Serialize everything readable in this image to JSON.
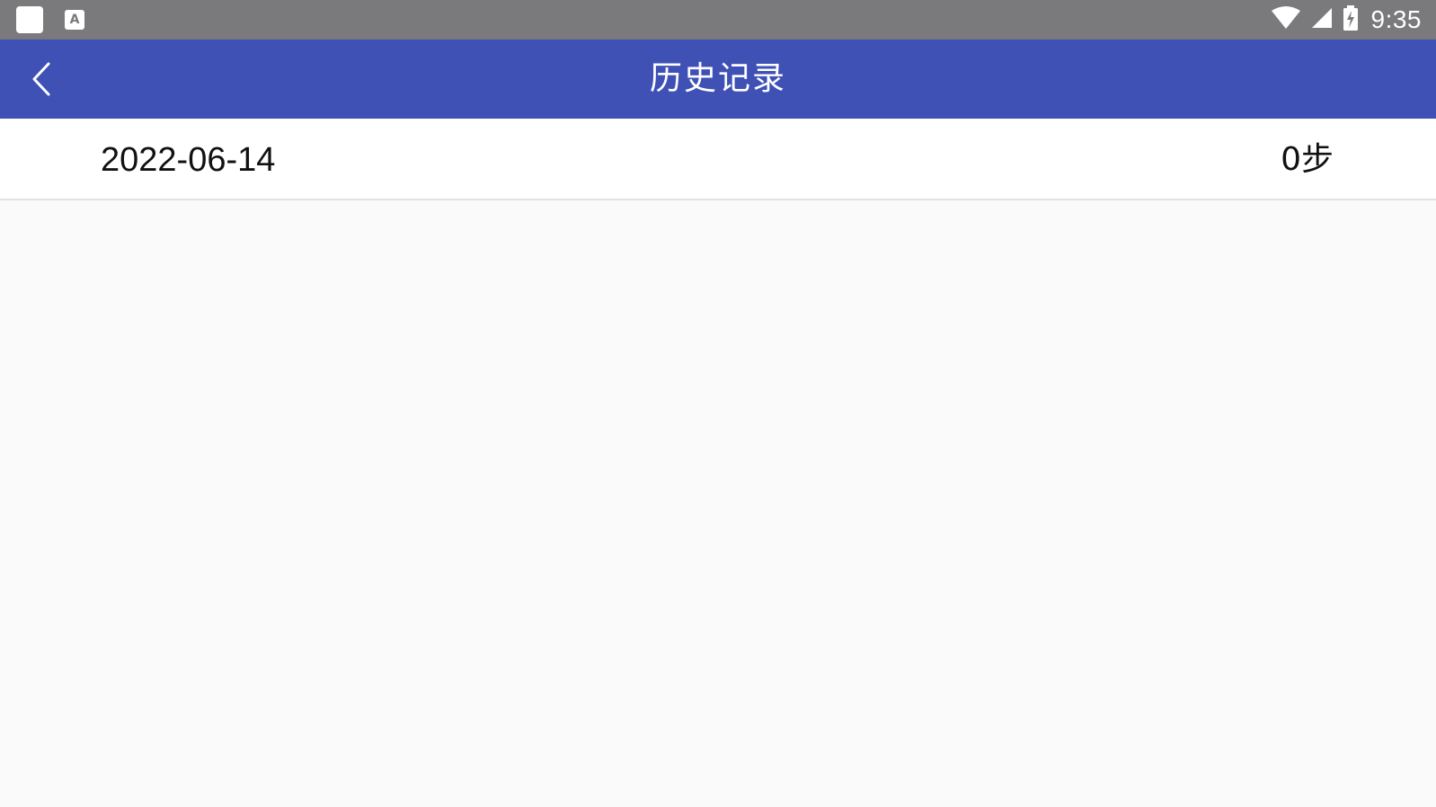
{
  "status_bar": {
    "time": "9:35",
    "notification_icons": [
      "app-square-icon",
      "keyboard-a-icon"
    ],
    "notification_a_letter": "A",
    "system_icons": [
      "wifi-icon",
      "cell-signal-icon",
      "battery-charging-icon"
    ]
  },
  "app_bar": {
    "title": "历史记录",
    "back_icon": "chevron-left-icon",
    "background_color": "#3f51b5",
    "title_color": "#ffffff"
  },
  "history": {
    "rows": [
      {
        "date": "2022-06-14",
        "steps": "0步"
      }
    ]
  },
  "colors": {
    "status_bar": "#7a797c",
    "page_background": "#fafafa",
    "row_background": "#ffffff",
    "divider": "#e2e2e2"
  }
}
